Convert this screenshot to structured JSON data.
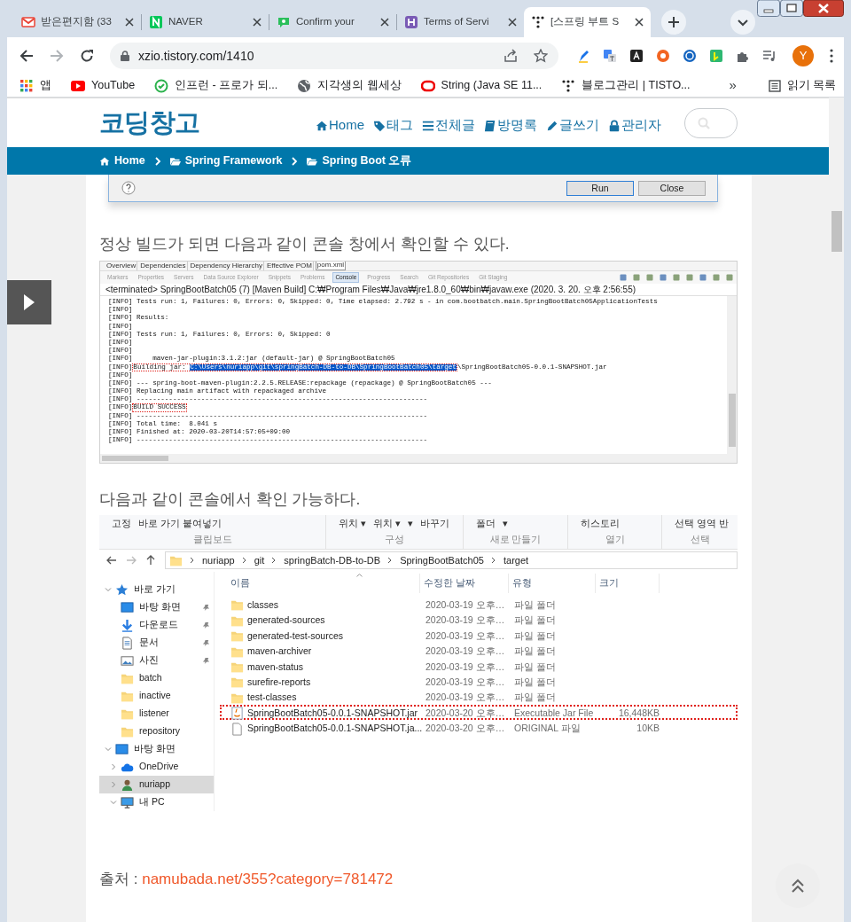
{
  "browser": {
    "tabs": [
      {
        "title": "받은편지함 (33",
        "kind": "mail",
        "selected": false
      },
      {
        "title": "NAVER",
        "kind": "square",
        "selected": false
      },
      {
        "title": "Confirm your",
        "kind": "chat",
        "selected": false
      },
      {
        "title": "Terms of Servi",
        "kind": "badge",
        "selected": false
      },
      {
        "title": "[스프링 부트 S",
        "kind": "dots",
        "selected": true
      }
    ],
    "address": "xzio.tistory.com/1410",
    "avatar": "Y",
    "bookmarks": [
      {
        "label": "앱",
        "kind": "grid"
      },
      {
        "label": "YouTube",
        "kind": "play"
      },
      {
        "label": "인프런 - 프로가 되...",
        "kind": "leaf"
      },
      {
        "label": "지각생의 웹세상",
        "kind": "globe"
      },
      {
        "label": "String (Java SE 11...",
        "kind": "ring"
      },
      {
        "label": "블로그관리 | TISTO...",
        "kind": "dots"
      }
    ],
    "more": "»",
    "reading_list": "읽기 목록"
  },
  "blog": {
    "title": "코딩창고",
    "nav": [
      {
        "label": "Home",
        "kind": "home"
      },
      {
        "label": "태그",
        "kind": "tag"
      },
      {
        "label": "전체글",
        "kind": "list"
      },
      {
        "label": "방명록",
        "kind": "book"
      },
      {
        "label": "글쓰기",
        "kind": "pencil"
      },
      {
        "label": "관리자",
        "kind": "lock"
      }
    ],
    "breadcrumb": [
      {
        "label": "Home",
        "kind": "home"
      },
      {
        "label": "Spring Framework",
        "kind": "folder"
      },
      {
        "label": "Spring Boot 오류",
        "kind": "folder"
      }
    ]
  },
  "content": [
    {
      "kind": "dialog",
      "buttons": [
        {
          "label": "Run",
          "default": true
        },
        {
          "label": "Close",
          "default": false
        }
      ]
    },
    {
      "kind": "text",
      "text": "정상 빌드가 되면 다음과 같이 콘솔 창에서 확인할 수 있다."
    },
    {
      "kind": "console",
      "editor_tabs": [
        {
          "label": "Overview",
          "selected": false
        },
        {
          "label": "Dependencies",
          "selected": false
        },
        {
          "label": "Dependency Hierarchy",
          "selected": false
        },
        {
          "label": "Effective POM",
          "selected": false
        },
        {
          "label": "pom.xml",
          "selected": true
        }
      ],
      "view_tabs": [
        {
          "label": "Markers",
          "selected": false
        },
        {
          "label": "Properties",
          "selected": false
        },
        {
          "label": "Servers",
          "selected": false
        },
        {
          "label": "Data Source Explorer",
          "selected": false
        },
        {
          "label": "Snippets",
          "selected": false
        },
        {
          "label": "Problems",
          "selected": false
        },
        {
          "label": "Console",
          "selected": true
        },
        {
          "label": "Progress",
          "selected": false
        },
        {
          "label": "Search",
          "selected": false
        },
        {
          "label": "Git Repositories",
          "selected": false
        },
        {
          "label": "Git Staging",
          "selected": false
        }
      ],
      "status": "<terminated> SpringBootBatch05 (7) [Maven Build] C:₩Program Files₩Java₩jre1.8.0_60₩bin₩javaw.exe (2020. 3. 20. 오후 2:56:55)",
      "lines": [
        {
          "segments": [
            {
              "text": "[INFO] Tests run: 1, Failures: 0, Errors: 0, Skipped: 0, Time elapsed: 2.792 s - in com.bootbatch.main.SpringBootBatch05ApplicationTests",
              "boxed": false,
              "selected": false
            }
          ]
        },
        {
          "segments": [
            {
              "text": "[INFO]",
              "boxed": false,
              "selected": false
            }
          ]
        },
        {
          "segments": [
            {
              "text": "[INFO] Results:",
              "boxed": false,
              "selected": false
            }
          ]
        },
        {
          "segments": [
            {
              "text": "[INFO]",
              "boxed": false,
              "selected": false
            }
          ]
        },
        {
          "segments": [
            {
              "text": "[INFO] Tests run: 1, Failures: 0, Errors: 0, Skipped: 0",
              "boxed": false,
              "selected": false
            }
          ]
        },
        {
          "segments": [
            {
              "text": "[INFO]",
              "boxed": false,
              "selected": false
            }
          ]
        },
        {
          "segments": [
            {
              "text": "[INFO]",
              "boxed": false,
              "selected": false
            }
          ]
        },
        {
          "segments": [
            {
              "text": "[INFO]     maven-jar-plugin:3.1.2:jar (default-jar) @ SpringBootBatch05",
              "boxed": false,
              "selected": false
            }
          ]
        },
        {
          "segments": [
            {
              "text": "[INFO]",
              "boxed": false,
              "selected": false
            },
            {
              "text": "Building jar: ",
              "boxed": true,
              "selected": false
            },
            {
              "text": "C:\\Users\\nuriapp\\git\\springBatch-DB-to-DB\\SpringBootBatch05\\target",
              "boxed": true,
              "selected": true
            },
            {
              "text": "\\SpringBootBatch05-0.0.1-SNAPSHOT.jar",
              "boxed": false,
              "selected": false
            }
          ]
        },
        {
          "segments": [
            {
              "text": "[INFO]",
              "boxed": false,
              "selected": false
            }
          ]
        },
        {
          "segments": [
            {
              "text": "[INFO] --- spring-boot-maven-plugin:2.2.5.RELEASE:repackage (repackage) @ SpringBootBatch05 ---",
              "boxed": false,
              "selected": false
            }
          ]
        },
        {
          "segments": [
            {
              "text": "[INFO] Replacing main artifact with repackaged archive",
              "boxed": false,
              "selected": false
            }
          ]
        },
        {
          "segments": [
            {
              "text": "[INFO] ------------------------------------------------------------------------",
              "boxed": false,
              "selected": false
            }
          ]
        },
        {
          "segments": [
            {
              "text": "[INFO]",
              "boxed": false,
              "selected": false
            },
            {
              "text": "BUILD SUCCESS",
              "boxed": true,
              "selected": false
            }
          ]
        },
        {
          "segments": [
            {
              "text": "[INFO] ------------------------------------------------------------------------",
              "boxed": false,
              "selected": false
            }
          ]
        },
        {
          "segments": [
            {
              "text": "[INFO] Total time:  8.041 s",
              "boxed": false,
              "selected": false
            }
          ]
        },
        {
          "segments": [
            {
              "text": "[INFO] Finished at: 2020-03-20T14:57:05+09:00",
              "boxed": false,
              "selected": false
            }
          ]
        },
        {
          "segments": [
            {
              "text": "[INFO] ------------------------------------------------------------------------",
              "boxed": false,
              "selected": false
            }
          ]
        }
      ]
    },
    {
      "kind": "text",
      "text": "다음과 같이 콘솔에서 확인 가능하다."
    },
    {
      "kind": "explorer",
      "groups": [
        {
          "label": "클립보드",
          "items": [
            "고정",
            "바로 가기 붙여넣기"
          ]
        },
        {
          "label": "구성",
          "items": [
            "위치 ▾",
            "위치 ▾",
            "▾",
            "바꾸기"
          ]
        },
        {
          "label": "새로 만들기",
          "items": [
            "폴더",
            "▾"
          ]
        },
        {
          "label": "열기",
          "items": [
            "히스토리"
          ]
        },
        {
          "label": "선택",
          "items": [
            "선택 영역 반"
          ]
        }
      ],
      "path": [
        "nuriapp",
        "git",
        "springBatch-DB-to-DB",
        "SpringBootBatch05",
        "target"
      ],
      "nav": [
        {
          "label": "바로 가기",
          "kind": "star",
          "expanded": true,
          "selected": false,
          "children": [
            {
              "label": "바탕 화면",
              "kind": "desktop",
              "pinned": true,
              "selected": false
            },
            {
              "label": "다운로드",
              "kind": "download",
              "pinned": true,
              "selected": false
            },
            {
              "label": "문서",
              "kind": "document",
              "pinned": true,
              "selected": false
            },
            {
              "label": "사진",
              "kind": "image",
              "pinned": true,
              "selected": false
            },
            {
              "label": "batch",
              "kind": "folder",
              "pinned": false,
              "selected": false
            },
            {
              "label": "inactive",
              "kind": "folder",
              "pinned": false,
              "selected": false
            },
            {
              "label": "listener",
              "kind": "folder",
              "pinned": false,
              "selected": false
            },
            {
              "label": "repository",
              "kind": "folder",
              "pinned": false,
              "selected": false
            }
          ]
        },
        {
          "label": "바탕 화면",
          "kind": "desktop",
          "expanded": true,
          "selected": false,
          "children": [
            {
              "label": "OneDrive",
              "kind": "cloud",
              "expanded": false,
              "selected": false
            },
            {
              "label": "nuriapp",
              "kind": "user",
              "expanded": false,
              "selected": true
            },
            {
              "label": "내 PC",
              "kind": "pc",
              "expanded": true,
              "selected": false
            }
          ]
        }
      ],
      "columns": [
        "이름",
        "수정한 날짜",
        "유형",
        "크기"
      ],
      "files": [
        {
          "name": "classes",
          "date": "2020-03-19 오후…",
          "type": "파일 폴더",
          "kind": "folder",
          "boxed": false
        },
        {
          "name": "generated-sources",
          "date": "2020-03-19 오후…",
          "type": "파일 폴더",
          "kind": "folder",
          "boxed": false
        },
        {
          "name": "generated-test-sources",
          "date": "2020-03-19 오후…",
          "type": "파일 폴더",
          "kind": "folder",
          "boxed": false
        },
        {
          "name": "maven-archiver",
          "date": "2020-03-19 오후…",
          "type": "파일 폴더",
          "kind": "folder",
          "boxed": false
        },
        {
          "name": "maven-status",
          "date": "2020-03-19 오후…",
          "type": "파일 폴더",
          "kind": "folder",
          "boxed": false
        },
        {
          "name": "surefire-reports",
          "date": "2020-03-19 오후…",
          "type": "파일 폴더",
          "kind": "folder",
          "boxed": false
        },
        {
          "name": "test-classes",
          "date": "2020-03-19 오후…",
          "type": "파일 폴더",
          "kind": "folder",
          "boxed": false
        },
        {
          "name": "SpringBootBatch05-0.0.1-SNAPSHOT.jar",
          "date": "2020-03-20 오후…",
          "type": "Executable Jar File",
          "size": "16,448KB",
          "kind": "jar",
          "boxed": true
        },
        {
          "name": "SpringBootBatch05-0.0.1-SNAPSHOT.ja...",
          "date": "2020-03-20 오후…",
          "type": "ORIGINAL 파일",
          "size": "10KB",
          "kind": "file",
          "boxed": false
        }
      ]
    },
    {
      "kind": "source",
      "label": "출처 : ",
      "link": "namubada.net/355?category=781472"
    }
  ]
}
